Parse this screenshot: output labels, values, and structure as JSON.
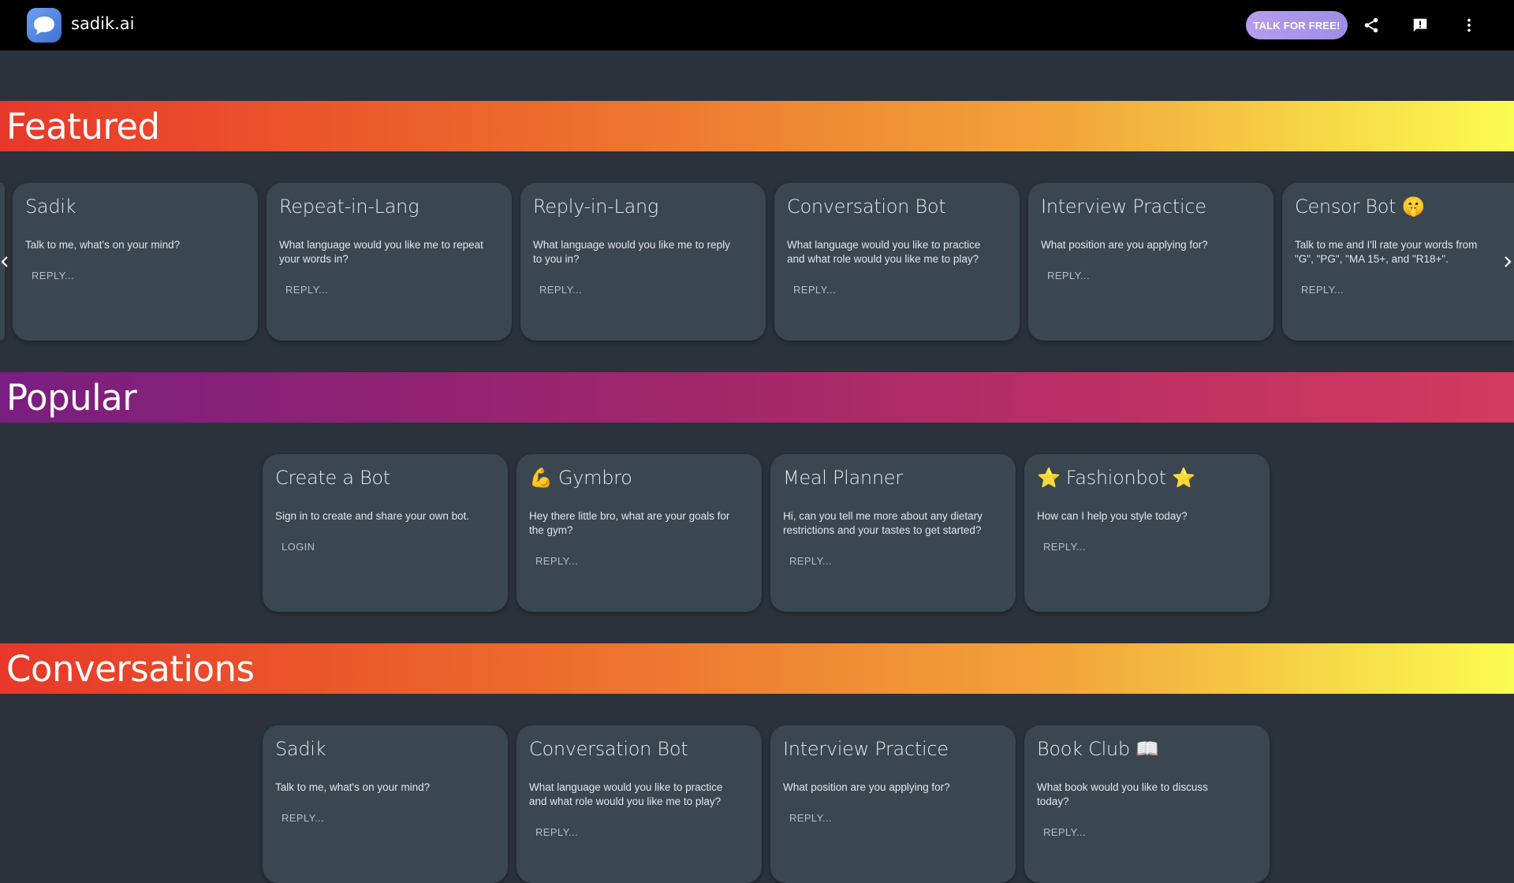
{
  "header": {
    "brand": "sadik.ai",
    "talk_button": "TALK FOR FREE!",
    "icons": [
      "chat-bubble-logo-icon",
      "share-icon",
      "feedback-icon",
      "more-vert-icon"
    ]
  },
  "sections": {
    "featured": {
      "title": "Featured",
      "cards": [
        {
          "title": "Sadik",
          "desc": "Talk to me, what's on your mind?",
          "action": "REPLY..."
        },
        {
          "title": "Repeat-in-Lang",
          "desc": "What language would you like me to repeat your words in?",
          "action": "REPLY..."
        },
        {
          "title": "Reply-in-Lang",
          "desc": "What language would you like me to reply to you in?",
          "action": "REPLY..."
        },
        {
          "title": "Conversation Bot",
          "desc": "What language would you like to practice and what role would you like me to play?",
          "action": "REPLY..."
        },
        {
          "title": "Interview Practice",
          "desc": "What position are you applying for?",
          "action": "REPLY..."
        },
        {
          "title": "Censor Bot 🤫",
          "desc": "Talk to me and I'll rate your words from \"G\", \"PG\", \"MA 15+, and \"R18+\".",
          "action": "REPLY..."
        }
      ]
    },
    "popular": {
      "title": "Popular",
      "cards": [
        {
          "title": "Create a Bot",
          "desc": "Sign in to create and share your own bot.",
          "action": "LOGIN"
        },
        {
          "title": "💪 Gymbro",
          "desc": "Hey there little bro, what are your goals for the gym?",
          "action": "REPLY..."
        },
        {
          "title": "Meal Planner",
          "desc": "Hi, can you tell me more about any dietary restrictions and your tastes to get started?",
          "action": "REPLY..."
        },
        {
          "title": "⭐ Fashionbot ⭐",
          "desc": "How can I help you style today?",
          "action": "REPLY..."
        }
      ]
    },
    "conversations": {
      "title": "Conversations",
      "cards": [
        {
          "title": "Sadik",
          "desc": "Talk to me, what's on your mind?",
          "action": "REPLY..."
        },
        {
          "title": "Conversation Bot",
          "desc": "What language would you like to practice and what role would you like me to play?",
          "action": "REPLY..."
        },
        {
          "title": "Interview Practice",
          "desc": "What position are you applying for?",
          "action": "REPLY..."
        },
        {
          "title": "Book Club 📖",
          "desc": "What book would you like to discuss today?",
          "action": "REPLY..."
        }
      ]
    }
  },
  "colors": {
    "background": "#2b323b",
    "topbar": "#000000",
    "card": "#3a4650",
    "talk_button": "#a995ec"
  }
}
